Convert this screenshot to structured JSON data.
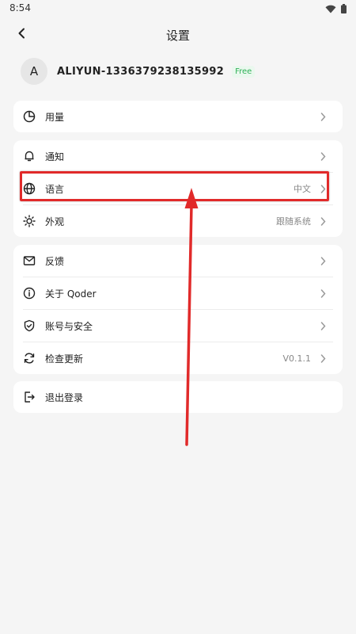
{
  "status_bar": {
    "time": "8:54",
    "icons": [
      "wifi-icon",
      "battery-icon"
    ]
  },
  "header": {
    "title": "设置",
    "back_icon": "back-arrow-icon"
  },
  "account": {
    "avatar_letter": "A",
    "name": "ALIYUN-1336379238135992",
    "plan": "Free"
  },
  "groups": [
    {
      "items": [
        {
          "icon": "pie-chart-icon",
          "label": "用量",
          "value": ""
        }
      ]
    },
    {
      "items": [
        {
          "icon": "bell-icon",
          "label": "通知",
          "value": ""
        },
        {
          "icon": "globe-icon",
          "label": "语言",
          "value": "中文"
        },
        {
          "icon": "sun-icon",
          "label": "外观",
          "value": "跟随系统"
        }
      ]
    },
    {
      "items": [
        {
          "icon": "mail-icon",
          "label": "反馈",
          "value": ""
        },
        {
          "icon": "info-icon",
          "label": "关于 Qoder",
          "value": ""
        },
        {
          "icon": "shield-icon",
          "label": "账号与安全",
          "value": ""
        },
        {
          "icon": "refresh-icon",
          "label": "检查更新",
          "value": "V0.1.1"
        }
      ]
    },
    {
      "items": [
        {
          "icon": "logout-icon",
          "label": "退出登录",
          "value": ""
        }
      ]
    }
  ],
  "colors": {
    "background": "#f5f5f5",
    "card": "#ffffff",
    "badge_green": "#2fb157",
    "annotation_red": "#e12a2a"
  }
}
